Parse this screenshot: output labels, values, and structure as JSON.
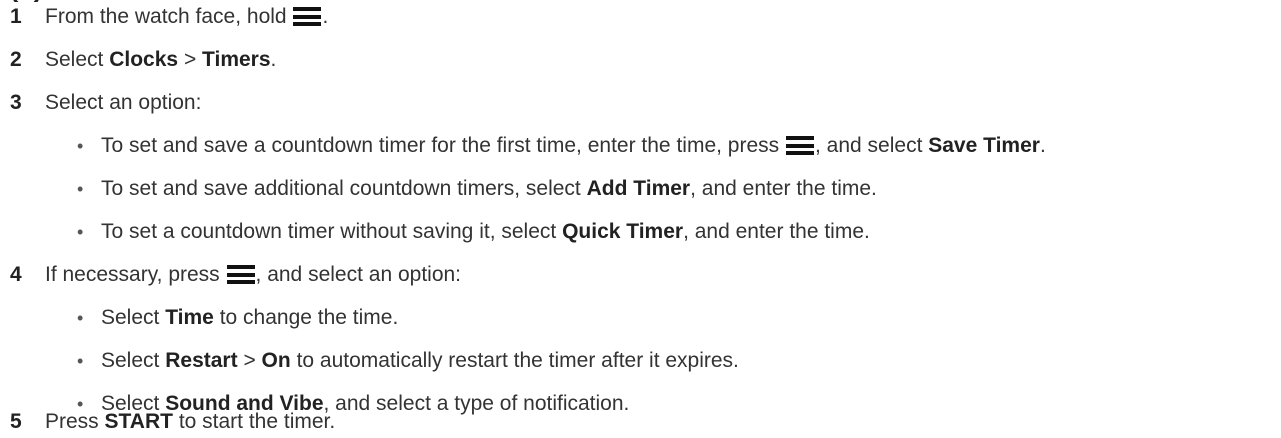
{
  "steps": [
    {
      "number": "1",
      "pre": "From the watch face, hold",
      "icon": "menu-icon",
      "post": "."
    },
    {
      "number": "2",
      "pre": "Select",
      "b1": "Clocks",
      "mid": ">",
      "b2": "Timers",
      "post": "."
    },
    {
      "number": "3",
      "text": "Select an option:",
      "bullets": [
        {
          "pre": "To set and save a countdown timer for the first time, enter the time, press",
          "icon": "menu-icon",
          "mid": ", and select",
          "bold": "Save Timer",
          "post": "."
        },
        {
          "pre": "To set and save additional countdown timers, select",
          "bold": "Add Timer",
          "post": ", and enter the time."
        },
        {
          "pre": "To set a countdown timer without saving it, select",
          "bold": "Quick Timer",
          "post": ", and enter the time."
        }
      ]
    },
    {
      "number": "4",
      "pre": "If necessary, press",
      "icon": "menu-icon",
      "post": ", and select an option:",
      "bullets": [
        {
          "pre": "Select",
          "bold": "Time",
          "post": "to change the time."
        },
        {
          "pre": "Select",
          "b1": "Restart",
          "mid": ">",
          "b2": "On",
          "post": "to automatically restart the timer after it expires."
        },
        {
          "pre": "Select",
          "bold": "Sound and Vibe",
          "post": ", and select a type of notification."
        }
      ]
    },
    {
      "number": "5",
      "pre": "Press",
      "bold": "START",
      "post": "to start the timer."
    }
  ],
  "bullet_glyph": "•"
}
